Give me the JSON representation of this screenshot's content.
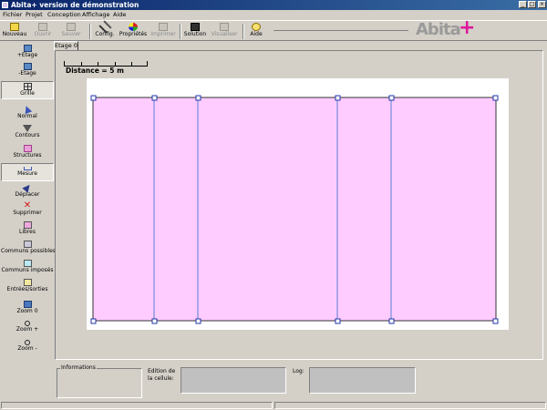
{
  "window": {
    "title": "Abita+ version de démonstration",
    "controls": [
      "_",
      "□",
      "×"
    ]
  },
  "menu": {
    "items": [
      "Fichier",
      "Projet",
      "Conception",
      "Affichage",
      "Aide"
    ]
  },
  "toolbar": {
    "nouveau": "Nouveau",
    "ouvrir": "Ouvrir",
    "sauver": "Sauver",
    "config": "Config.",
    "proprietes": "Propriétés",
    "imprimer": "Imprimer",
    "solution": "Solution",
    "visualiser": "Visualiser",
    "aide": "Aide",
    "logo_text": "Abita",
    "logo_plus": "+",
    "colors": {
      "logo_plus": "#e0189c"
    }
  },
  "palette": {
    "add_floor": "+Etage",
    "remove_floor": "-Etage",
    "grid": "Grille",
    "normal": "Normal",
    "contours": "Contours",
    "structures": "Structures",
    "measure": "Mesure",
    "move": "Déplacer",
    "delete": "Supprimer",
    "free": "Libres",
    "common_possible": "Communs possibles",
    "common_imposed": "Communs imposés",
    "entries_exits": "Entrées/sorties",
    "zoom_reset": "Zoom 0",
    "zoom_in": "Zoom +",
    "zoom_out": "Zoom -"
  },
  "canvas": {
    "tab": "Etage 0",
    "distance_label": "Distance = 5 m",
    "colors": {
      "zone_fill": "#ffccff",
      "handle": "#1f35a8",
      "grid_line": "#5a7fd6"
    }
  },
  "bottom": {
    "informations_label": "Informations",
    "cell_edit_label_1": "Edition de",
    "cell_edit_label_2": "la cellule:",
    "log_label": "Log:"
  }
}
